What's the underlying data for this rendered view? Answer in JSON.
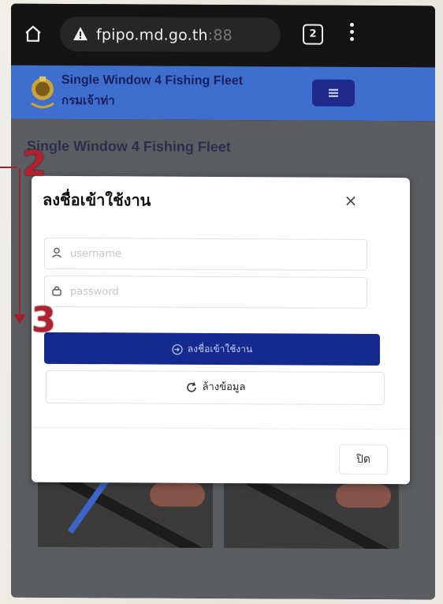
{
  "browser": {
    "url_main": "fpipo.md.go.th",
    "url_port": ":88",
    "tab_count": "2"
  },
  "site": {
    "title": "Single Window 4 Fishing Fleet",
    "subtitle": "กรมเจ้าท่า",
    "page_heading": "Single Window 4 Fishing Fleet"
  },
  "modal": {
    "title": "ลงชื่อเข้าใช้งาน",
    "close_symbol": "×",
    "username_placeholder": "username",
    "password_placeholder": "password",
    "login_label": "ลงชื่อเข้าใช้งาน",
    "clear_label": "ล้างข้อมูล",
    "dismiss_label": "ปิด"
  },
  "annotations": {
    "step_a": "2",
    "step_b": "3"
  },
  "colors": {
    "header_blue": "#3e6fce",
    "primary_button": "#152a8e",
    "annotation_red": "#a51f2b"
  },
  "icons": {
    "home": "home-icon",
    "warning": "warning-icon",
    "tabs": "tabs-icon",
    "menu": "more-vert-icon",
    "hamburger": "hamburger-icon",
    "user": "user-icon",
    "lock": "lock-icon",
    "login": "login-icon",
    "refresh": "refresh-icon"
  }
}
